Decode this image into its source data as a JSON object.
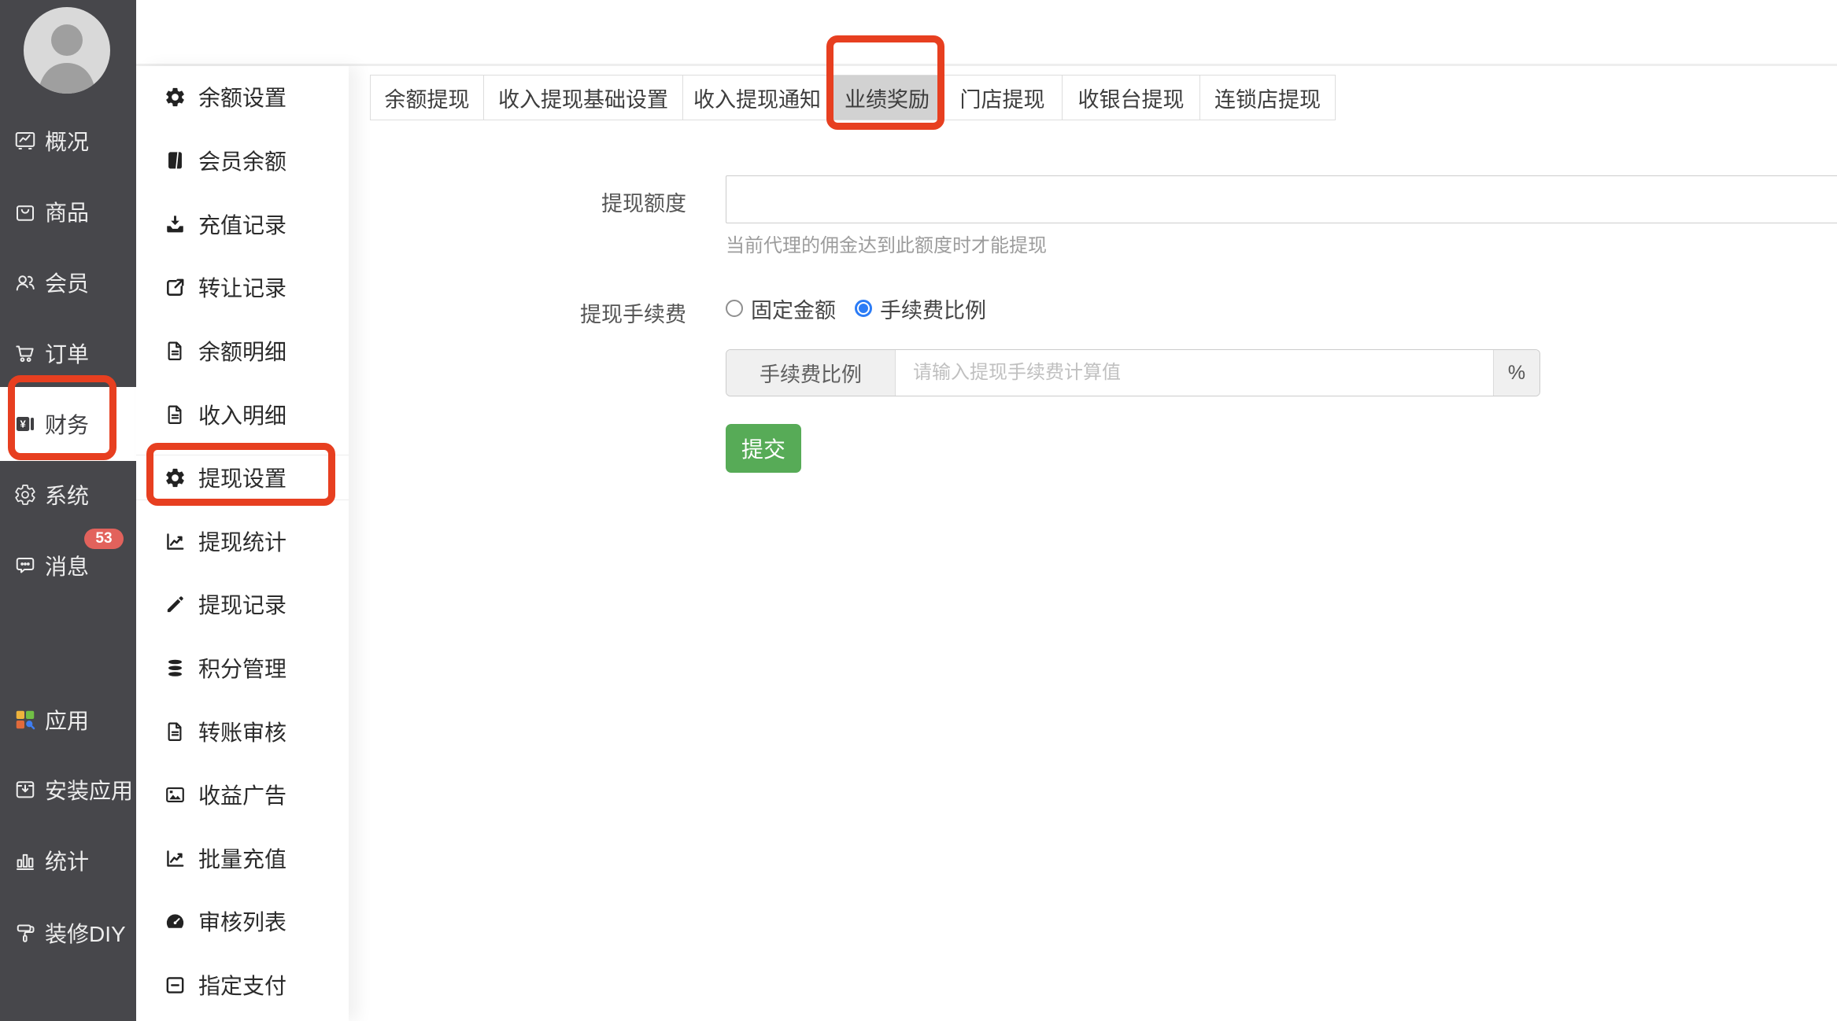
{
  "sidebar": {
    "items": [
      {
        "label": "概况"
      },
      {
        "label": "商品"
      },
      {
        "label": "会员"
      },
      {
        "label": "订单"
      },
      {
        "label": "财务"
      },
      {
        "label": "系统"
      },
      {
        "label": "消息"
      },
      {
        "label": "应用"
      },
      {
        "label": "安装应用"
      },
      {
        "label": "统计"
      },
      {
        "label": "装修DIY"
      }
    ],
    "message_badge": "53"
  },
  "submenu": {
    "items": [
      {
        "label": "余额设置"
      },
      {
        "label": "会员余额"
      },
      {
        "label": "充值记录"
      },
      {
        "label": "转让记录"
      },
      {
        "label": "余额明细"
      },
      {
        "label": "收入明细"
      },
      {
        "label": "提现设置"
      },
      {
        "label": "提现统计"
      },
      {
        "label": "提现记录"
      },
      {
        "label": "积分管理"
      },
      {
        "label": "转账审核"
      },
      {
        "label": "收益广告"
      },
      {
        "label": "批量充值"
      },
      {
        "label": "审核列表"
      },
      {
        "label": "指定支付"
      }
    ],
    "active": "提现设置"
  },
  "tabs": {
    "items": [
      {
        "label": "余额提现"
      },
      {
        "label": "收入提现基础设置"
      },
      {
        "label": "收入提现通知"
      },
      {
        "label": "业绩奖励"
      },
      {
        "label": "门店提现"
      },
      {
        "label": "收银台提现"
      },
      {
        "label": "连锁店提现"
      }
    ],
    "selected": "业绩奖励"
  },
  "form": {
    "amount_label": "提现额度",
    "amount_value": "",
    "amount_help": "当前代理的佣金达到此额度时才能提现",
    "fee_label": "提现手续费",
    "radio_fixed_label": "固定金额",
    "radio_ratio_label": "手续费比例",
    "fee_prefix": "手续费比例",
    "fee_placeholder": "请输入提现手续费计算值",
    "fee_suffix": "%",
    "submit_label": "提交"
  },
  "colors": {
    "sidebar_bg": "#47474b",
    "annotation_red": "#e73f20",
    "radio_blue": "#2b7cf6",
    "submit_green": "#57ab57",
    "badge_red": "#e2625c",
    "selected_tab_gray": "#d2d2d2"
  }
}
